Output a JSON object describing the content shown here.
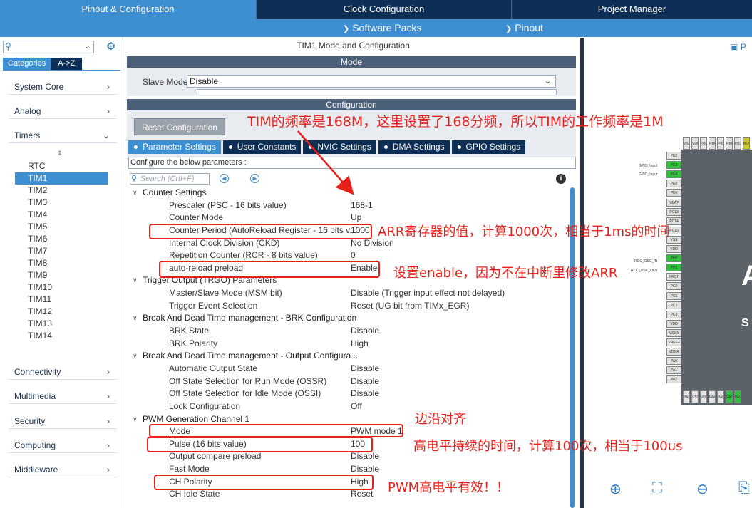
{
  "tabs": {
    "pinout": "Pinout & Configuration",
    "clock": "Clock Configuration",
    "project": "Project Manager"
  },
  "submenu": {
    "software_packs": "Software Packs",
    "pinout": "Pinout"
  },
  "left": {
    "cat_tab_categories": "Categories",
    "cat_tab_az": "A->Z",
    "groups": {
      "system_core": "System Core",
      "analog": "Analog",
      "timers": "Timers",
      "connectivity": "Connectivity",
      "multimedia": "Multimedia",
      "security": "Security",
      "computing": "Computing",
      "middleware": "Middleware"
    },
    "timers": [
      "RTC",
      "TIM1",
      "TIM2",
      "TIM3",
      "TIM4",
      "TIM5",
      "TIM6",
      "TIM7",
      "TIM8",
      "TIM9",
      "TIM10",
      "TIM11",
      "TIM12",
      "TIM13",
      "TIM14"
    ],
    "selected": "TIM1"
  },
  "mid": {
    "title": "TIM1 Mode and Configuration",
    "mode_header": "Mode",
    "slave_mode_label": "Slave Mode",
    "slave_mode_value": "Disable",
    "config_header": "Configuration",
    "reset_button": "Reset Configuration",
    "param_tabs": {
      "parameter": "Parameter Settings",
      "user": "User Constants",
      "nvic": "NVIC Settings",
      "dma": "DMA Settings",
      "gpio": "GPIO Settings"
    },
    "hint": "Configure the below parameters :",
    "search_placeholder": "Search (Crtl+F)",
    "params": [
      {
        "g": true,
        "name": "Counter Settings"
      },
      {
        "name": "Prescaler (PSC - 16 bits value)",
        "value": "168-1"
      },
      {
        "name": "Counter Mode",
        "value": "Up"
      },
      {
        "name": "Counter Period (AutoReload Register - 16 bits v...",
        "value": "1000"
      },
      {
        "name": "Internal Clock Division (CKD)",
        "value": "No Division"
      },
      {
        "name": "Repetition Counter (RCR - 8 bits value)",
        "value": "0"
      },
      {
        "name": "auto-reload preload",
        "value": "Enable"
      },
      {
        "g": true,
        "name": "Trigger Output (TRGO) Parameters"
      },
      {
        "name": "Master/Slave Mode (MSM bit)",
        "value": "Disable (Trigger input effect not delayed)"
      },
      {
        "name": "Trigger Event Selection",
        "value": "Reset (UG bit from TIMx_EGR)"
      },
      {
        "g": true,
        "name": "Break And Dead Time management - BRK Configuration"
      },
      {
        "name": "BRK State",
        "value": "Disable"
      },
      {
        "name": "BRK Polarity",
        "value": "High"
      },
      {
        "g": true,
        "name": "Break And Dead Time management - Output Configura..."
      },
      {
        "name": "Automatic Output State",
        "value": "Disable"
      },
      {
        "name": "Off State Selection for Run Mode (OSSR)",
        "value": "Disable"
      },
      {
        "name": "Off State Selection for Idle Mode (OSSI)",
        "value": "Disable"
      },
      {
        "name": "Lock Configuration",
        "value": "Off"
      },
      {
        "g": true,
        "name": "PWM Generation Channel 1"
      },
      {
        "name": "Mode",
        "value": "PWM mode 1"
      },
      {
        "name": "Pulse (16 bits value)",
        "value": "100"
      },
      {
        "name": "Output compare preload",
        "value": "Disable"
      },
      {
        "name": "Fast Mode",
        "value": "Disable"
      },
      {
        "name": "CH Polarity",
        "value": "High"
      },
      {
        "name": "CH Idle State",
        "value": "Reset"
      }
    ]
  },
  "right": {
    "tab": "P",
    "pins_top": [
      "VSS",
      "VDD",
      "PB3",
      "PB4",
      "PB5",
      "PB6",
      "PB7",
      "BOOT0"
    ],
    "pins_left": [
      "PE2",
      "PE3",
      "PE4",
      "PE5",
      "PE6",
      "VBAT",
      "PC13",
      "PC14",
      "PC15",
      "VSS",
      "VDD",
      "PH0",
      "PH1",
      "NRST",
      "PC0",
      "PC1",
      "PC2",
      "PC3",
      "VDD",
      "VSSA",
      "VREF+",
      "VDDA",
      "PA0",
      "PA1",
      "PA2"
    ],
    "pins_bottom": [
      "PA3",
      "VSS",
      "VDD",
      "PA4",
      "PA5",
      "PA6",
      "PA7"
    ],
    "label_gpio_input_1": "GPIO_Input",
    "label_gpio_input_2": "GPIO_Input",
    "label_rcc_1": "RCC_OSC_IN",
    "label_rcc_2": "RCC_OSC_OUT",
    "big_a": "A",
    "big_s": "S"
  },
  "annotations": {
    "freq": "TIM的频率是168M，这里设置了168分频，所以TIM的工作频率是1M",
    "arr": "ARR寄存器的值，计算1000次，相当于1ms的时间",
    "enable": "设置enable，因为不在中断里修改ARR",
    "edge": "边沿对齐",
    "pulse": "高电平持续的时间，计算100次，相当于100us",
    "polarity": "PWM高电平有效！！"
  },
  "colors": {
    "nav_dark": "#0e2f55",
    "nav_accent": "#3d8fd1",
    "annotation_red": "#e8201a",
    "pin_green": "#2fbf3a"
  }
}
